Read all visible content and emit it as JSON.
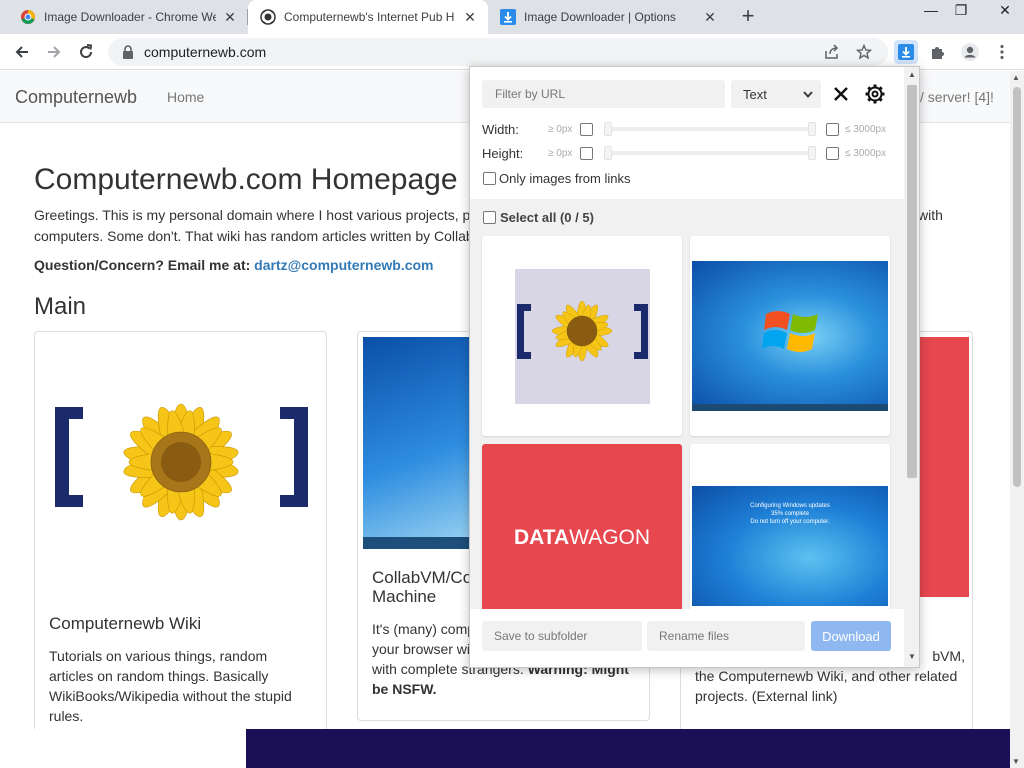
{
  "browser": {
    "tabs": [
      {
        "title": "Image Downloader - Chrome We",
        "icon": "chrome-webstore-icon"
      },
      {
        "title": "Computernewb's Internet Pub H",
        "icon": "site-logo-icon"
      },
      {
        "title": "Image Downloader | Options",
        "icon": "download-arrow-icon"
      }
    ],
    "url": "computernewb.com"
  },
  "site": {
    "brand": "Computernewb",
    "nav_home": "Home",
    "nav_right": "/ server! [4]!",
    "heading": "Computernewb.com Homepage",
    "intro_line1": "Greetings. This is my personal domain where I host various projects, p",
    "intro_line1_tail": "with",
    "intro_line2": "computers. Some don't. That wiki has random articles written by Collab",
    "question_label": "Question/Concern? Email me at:",
    "email": "dartz@computernewb.com",
    "section": "Main",
    "cards": [
      {
        "title": "Computernewb Wiki",
        "text_lines": [
          "Tutorials on various things, random",
          "articles on random things. Basically",
          "WikiBooks/Wikipedia without the stupid",
          "rules."
        ]
      },
      {
        "title_lines": [
          "CollabVM/Co",
          "Machine"
        ],
        "text_lines": [
          "It's (many) comp",
          "your browser wi",
          "with complete strangers."
        ],
        "warning": "Warning: Might",
        "warning_line2": "be NSFW."
      },
      {
        "text_tail_lines": [
          "bVM,",
          "the Computernewb Wiki, and other related",
          "projects. (External link)"
        ]
      }
    ]
  },
  "popup": {
    "filter_placeholder": "Filter by URL",
    "filter_mode": "Text",
    "width_label": "Width:",
    "height_label": "Height:",
    "min_label": "≥ 0px",
    "max_label": "≤ 3000px",
    "only_links": "Only images from links",
    "select_all": "Select all (0 / 5)",
    "images": [
      {
        "name": "sunflower-logo"
      },
      {
        "name": "windows-7-desktop"
      },
      {
        "name": "datawagon-logo",
        "text_bold": "DATA",
        "text_light": "WAGON"
      },
      {
        "name": "windows-update-screen",
        "line1": "Configuring Windows updates",
        "line2": "35% complete",
        "line3": "Do not turn off your computer."
      }
    ],
    "subfolder_placeholder": "Save to subfolder",
    "rename_placeholder": "Rename files",
    "download_label": "Download"
  },
  "colors": {
    "download_button": "#8fb8f0",
    "datawagon_bg": "#e7474f",
    "bottom_strip": "#1b1057",
    "link": "#337ab7"
  }
}
